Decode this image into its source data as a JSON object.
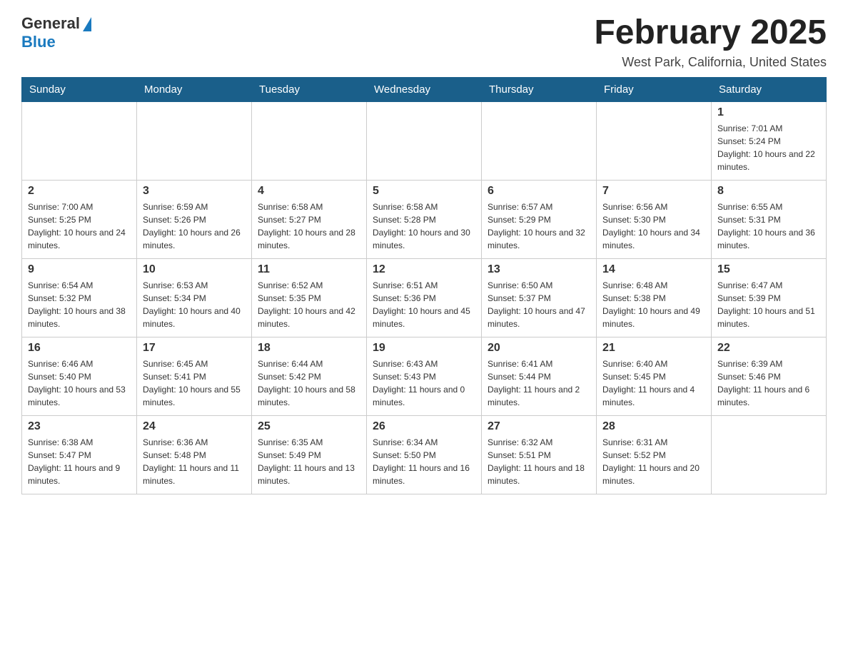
{
  "logo": {
    "general": "General",
    "blue": "Blue"
  },
  "title": "February 2025",
  "location": "West Park, California, United States",
  "days_header": [
    "Sunday",
    "Monday",
    "Tuesday",
    "Wednesday",
    "Thursday",
    "Friday",
    "Saturday"
  ],
  "weeks": [
    [
      {
        "day": "",
        "info": ""
      },
      {
        "day": "",
        "info": ""
      },
      {
        "day": "",
        "info": ""
      },
      {
        "day": "",
        "info": ""
      },
      {
        "day": "",
        "info": ""
      },
      {
        "day": "",
        "info": ""
      },
      {
        "day": "1",
        "info": "Sunrise: 7:01 AM\nSunset: 5:24 PM\nDaylight: 10 hours and 22 minutes."
      }
    ],
    [
      {
        "day": "2",
        "info": "Sunrise: 7:00 AM\nSunset: 5:25 PM\nDaylight: 10 hours and 24 minutes."
      },
      {
        "day": "3",
        "info": "Sunrise: 6:59 AM\nSunset: 5:26 PM\nDaylight: 10 hours and 26 minutes."
      },
      {
        "day": "4",
        "info": "Sunrise: 6:58 AM\nSunset: 5:27 PM\nDaylight: 10 hours and 28 minutes."
      },
      {
        "day": "5",
        "info": "Sunrise: 6:58 AM\nSunset: 5:28 PM\nDaylight: 10 hours and 30 minutes."
      },
      {
        "day": "6",
        "info": "Sunrise: 6:57 AM\nSunset: 5:29 PM\nDaylight: 10 hours and 32 minutes."
      },
      {
        "day": "7",
        "info": "Sunrise: 6:56 AM\nSunset: 5:30 PM\nDaylight: 10 hours and 34 minutes."
      },
      {
        "day": "8",
        "info": "Sunrise: 6:55 AM\nSunset: 5:31 PM\nDaylight: 10 hours and 36 minutes."
      }
    ],
    [
      {
        "day": "9",
        "info": "Sunrise: 6:54 AM\nSunset: 5:32 PM\nDaylight: 10 hours and 38 minutes."
      },
      {
        "day": "10",
        "info": "Sunrise: 6:53 AM\nSunset: 5:34 PM\nDaylight: 10 hours and 40 minutes."
      },
      {
        "day": "11",
        "info": "Sunrise: 6:52 AM\nSunset: 5:35 PM\nDaylight: 10 hours and 42 minutes."
      },
      {
        "day": "12",
        "info": "Sunrise: 6:51 AM\nSunset: 5:36 PM\nDaylight: 10 hours and 45 minutes."
      },
      {
        "day": "13",
        "info": "Sunrise: 6:50 AM\nSunset: 5:37 PM\nDaylight: 10 hours and 47 minutes."
      },
      {
        "day": "14",
        "info": "Sunrise: 6:48 AM\nSunset: 5:38 PM\nDaylight: 10 hours and 49 minutes."
      },
      {
        "day": "15",
        "info": "Sunrise: 6:47 AM\nSunset: 5:39 PM\nDaylight: 10 hours and 51 minutes."
      }
    ],
    [
      {
        "day": "16",
        "info": "Sunrise: 6:46 AM\nSunset: 5:40 PM\nDaylight: 10 hours and 53 minutes."
      },
      {
        "day": "17",
        "info": "Sunrise: 6:45 AM\nSunset: 5:41 PM\nDaylight: 10 hours and 55 minutes."
      },
      {
        "day": "18",
        "info": "Sunrise: 6:44 AM\nSunset: 5:42 PM\nDaylight: 10 hours and 58 minutes."
      },
      {
        "day": "19",
        "info": "Sunrise: 6:43 AM\nSunset: 5:43 PM\nDaylight: 11 hours and 0 minutes."
      },
      {
        "day": "20",
        "info": "Sunrise: 6:41 AM\nSunset: 5:44 PM\nDaylight: 11 hours and 2 minutes."
      },
      {
        "day": "21",
        "info": "Sunrise: 6:40 AM\nSunset: 5:45 PM\nDaylight: 11 hours and 4 minutes."
      },
      {
        "day": "22",
        "info": "Sunrise: 6:39 AM\nSunset: 5:46 PM\nDaylight: 11 hours and 6 minutes."
      }
    ],
    [
      {
        "day": "23",
        "info": "Sunrise: 6:38 AM\nSunset: 5:47 PM\nDaylight: 11 hours and 9 minutes."
      },
      {
        "day": "24",
        "info": "Sunrise: 6:36 AM\nSunset: 5:48 PM\nDaylight: 11 hours and 11 minutes."
      },
      {
        "day": "25",
        "info": "Sunrise: 6:35 AM\nSunset: 5:49 PM\nDaylight: 11 hours and 13 minutes."
      },
      {
        "day": "26",
        "info": "Sunrise: 6:34 AM\nSunset: 5:50 PM\nDaylight: 11 hours and 16 minutes."
      },
      {
        "day": "27",
        "info": "Sunrise: 6:32 AM\nSunset: 5:51 PM\nDaylight: 11 hours and 18 minutes."
      },
      {
        "day": "28",
        "info": "Sunrise: 6:31 AM\nSunset: 5:52 PM\nDaylight: 11 hours and 20 minutes."
      },
      {
        "day": "",
        "info": ""
      }
    ]
  ]
}
